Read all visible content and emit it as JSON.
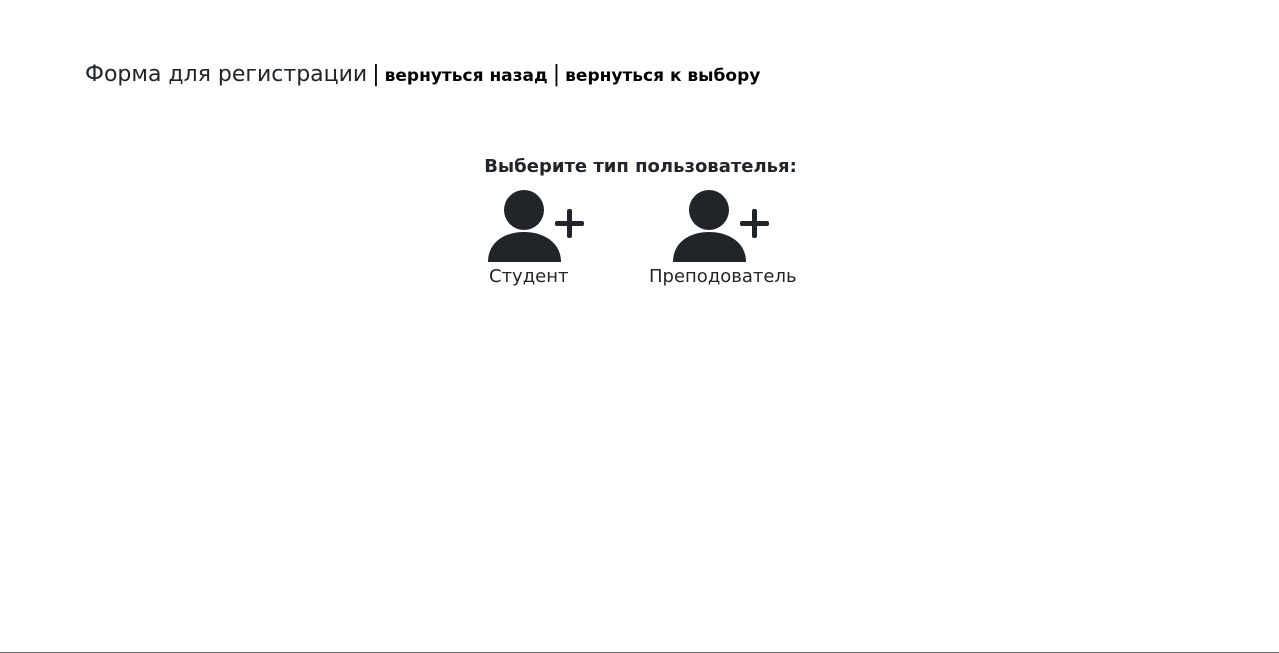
{
  "header": {
    "title": "Форма для регистрации",
    "separator": "|",
    "back_link": "вернуться назад",
    "choice_link": "вернуться к выбору"
  },
  "chooser": {
    "prompt": "Выберите тип пользователья:",
    "options": [
      {
        "label": "Студент",
        "icon": "person-plus-icon"
      },
      {
        "label": "Преподователь",
        "icon": "person-plus-icon"
      }
    ]
  },
  "colors": {
    "text": "#212529",
    "link": "#000000",
    "background": "#ffffff"
  }
}
